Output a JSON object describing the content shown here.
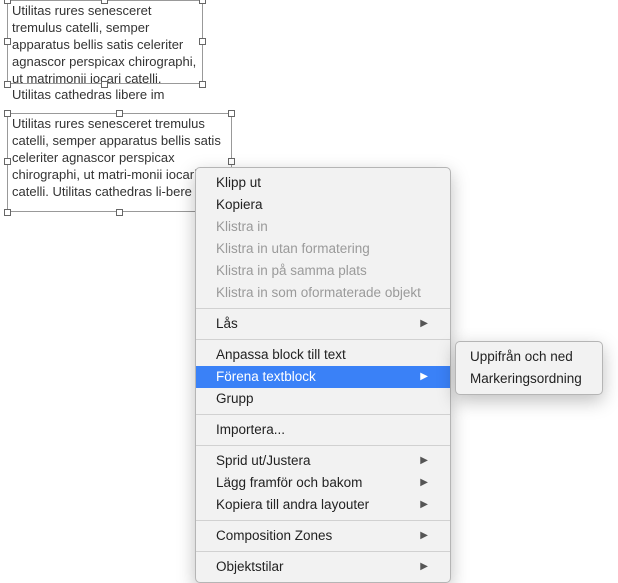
{
  "textblocks": {
    "a": "Utilitas rures senesceret tremulus catelli, semper apparatus bellis satis celeriter agnascor perspicax chirographi, ut matrimonii iocari catelli. Utilitas cathedras libere im",
    "b": "Utilitas rures senesceret tremulus catelli, semper apparatus bellis satis celeriter agnascor perspicax chirographi, ut matri-monii iocari catelli. Utilitas cathedras li-bere im"
  },
  "menu": {
    "cut": "Klipp ut",
    "copy": "Kopiera",
    "paste": "Klistra in",
    "paste_no_format": "Klistra in utan formatering",
    "paste_in_place": "Klistra in på samma plats",
    "paste_unformatted_obj": "Klistra in som oformaterade objekt",
    "lock": "Lås",
    "fit_box": "Anpassa block till text",
    "merge_text": "Förena textblock",
    "group": "Grupp",
    "import": "Importera...",
    "spread": "Sprid ut/Justera",
    "arrange": "Lägg framför och bakom",
    "copy_layouts": "Kopiera till andra layouter",
    "composition": "Composition Zones",
    "obj_styles": "Objektstilar"
  },
  "submenu": {
    "top_down": "Uppifrån och ned",
    "selection_order": "Markeringsordning"
  }
}
